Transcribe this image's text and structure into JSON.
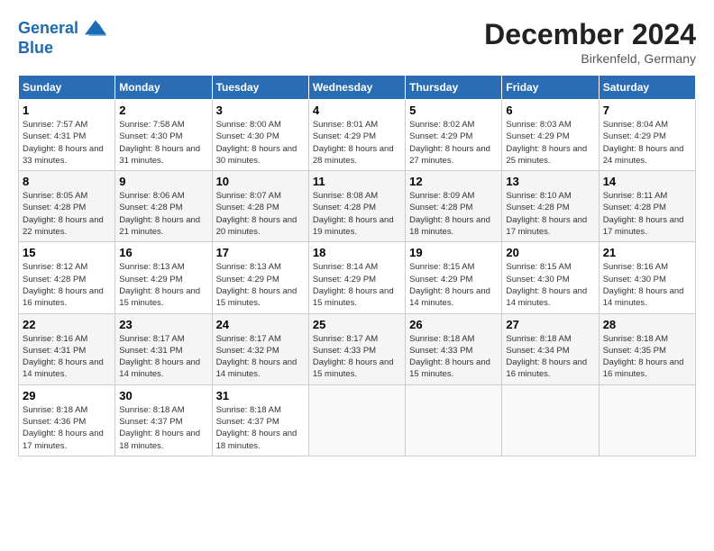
{
  "header": {
    "logo_line1": "General",
    "logo_line2": "Blue",
    "month_title": "December 2024",
    "location": "Birkenfeld, Germany"
  },
  "weekdays": [
    "Sunday",
    "Monday",
    "Tuesday",
    "Wednesday",
    "Thursday",
    "Friday",
    "Saturday"
  ],
  "weeks": [
    [
      {
        "day": "1",
        "sunrise": "7:57 AM",
        "sunset": "4:31 PM",
        "daylight": "8 hours and 33 minutes."
      },
      {
        "day": "2",
        "sunrise": "7:58 AM",
        "sunset": "4:30 PM",
        "daylight": "8 hours and 31 minutes."
      },
      {
        "day": "3",
        "sunrise": "8:00 AM",
        "sunset": "4:30 PM",
        "daylight": "8 hours and 30 minutes."
      },
      {
        "day": "4",
        "sunrise": "8:01 AM",
        "sunset": "4:29 PM",
        "daylight": "8 hours and 28 minutes."
      },
      {
        "day": "5",
        "sunrise": "8:02 AM",
        "sunset": "4:29 PM",
        "daylight": "8 hours and 27 minutes."
      },
      {
        "day": "6",
        "sunrise": "8:03 AM",
        "sunset": "4:29 PM",
        "daylight": "8 hours and 25 minutes."
      },
      {
        "day": "7",
        "sunrise": "8:04 AM",
        "sunset": "4:29 PM",
        "daylight": "8 hours and 24 minutes."
      }
    ],
    [
      {
        "day": "8",
        "sunrise": "8:05 AM",
        "sunset": "4:28 PM",
        "daylight": "8 hours and 22 minutes."
      },
      {
        "day": "9",
        "sunrise": "8:06 AM",
        "sunset": "4:28 PM",
        "daylight": "8 hours and 21 minutes."
      },
      {
        "day": "10",
        "sunrise": "8:07 AM",
        "sunset": "4:28 PM",
        "daylight": "8 hours and 20 minutes."
      },
      {
        "day": "11",
        "sunrise": "8:08 AM",
        "sunset": "4:28 PM",
        "daylight": "8 hours and 19 minutes."
      },
      {
        "day": "12",
        "sunrise": "8:09 AM",
        "sunset": "4:28 PM",
        "daylight": "8 hours and 18 minutes."
      },
      {
        "day": "13",
        "sunrise": "8:10 AM",
        "sunset": "4:28 PM",
        "daylight": "8 hours and 17 minutes."
      },
      {
        "day": "14",
        "sunrise": "8:11 AM",
        "sunset": "4:28 PM",
        "daylight": "8 hours and 17 minutes."
      }
    ],
    [
      {
        "day": "15",
        "sunrise": "8:12 AM",
        "sunset": "4:28 PM",
        "daylight": "8 hours and 16 minutes."
      },
      {
        "day": "16",
        "sunrise": "8:13 AM",
        "sunset": "4:29 PM",
        "daylight": "8 hours and 15 minutes."
      },
      {
        "day": "17",
        "sunrise": "8:13 AM",
        "sunset": "4:29 PM",
        "daylight": "8 hours and 15 minutes."
      },
      {
        "day": "18",
        "sunrise": "8:14 AM",
        "sunset": "4:29 PM",
        "daylight": "8 hours and 15 minutes."
      },
      {
        "day": "19",
        "sunrise": "8:15 AM",
        "sunset": "4:29 PM",
        "daylight": "8 hours and 14 minutes."
      },
      {
        "day": "20",
        "sunrise": "8:15 AM",
        "sunset": "4:30 PM",
        "daylight": "8 hours and 14 minutes."
      },
      {
        "day": "21",
        "sunrise": "8:16 AM",
        "sunset": "4:30 PM",
        "daylight": "8 hours and 14 minutes."
      }
    ],
    [
      {
        "day": "22",
        "sunrise": "8:16 AM",
        "sunset": "4:31 PM",
        "daylight": "8 hours and 14 minutes."
      },
      {
        "day": "23",
        "sunrise": "8:17 AM",
        "sunset": "4:31 PM",
        "daylight": "8 hours and 14 minutes."
      },
      {
        "day": "24",
        "sunrise": "8:17 AM",
        "sunset": "4:32 PM",
        "daylight": "8 hours and 14 minutes."
      },
      {
        "day": "25",
        "sunrise": "8:17 AM",
        "sunset": "4:33 PM",
        "daylight": "8 hours and 15 minutes."
      },
      {
        "day": "26",
        "sunrise": "8:18 AM",
        "sunset": "4:33 PM",
        "daylight": "8 hours and 15 minutes."
      },
      {
        "day": "27",
        "sunrise": "8:18 AM",
        "sunset": "4:34 PM",
        "daylight": "8 hours and 16 minutes."
      },
      {
        "day": "28",
        "sunrise": "8:18 AM",
        "sunset": "4:35 PM",
        "daylight": "8 hours and 16 minutes."
      }
    ],
    [
      {
        "day": "29",
        "sunrise": "8:18 AM",
        "sunset": "4:36 PM",
        "daylight": "8 hours and 17 minutes."
      },
      {
        "day": "30",
        "sunrise": "8:18 AM",
        "sunset": "4:37 PM",
        "daylight": "8 hours and 18 minutes."
      },
      {
        "day": "31",
        "sunrise": "8:18 AM",
        "sunset": "4:37 PM",
        "daylight": "8 hours and 18 minutes."
      },
      null,
      null,
      null,
      null
    ]
  ],
  "labels": {
    "sunrise": "Sunrise:",
    "sunset": "Sunset:",
    "daylight": "Daylight:"
  }
}
